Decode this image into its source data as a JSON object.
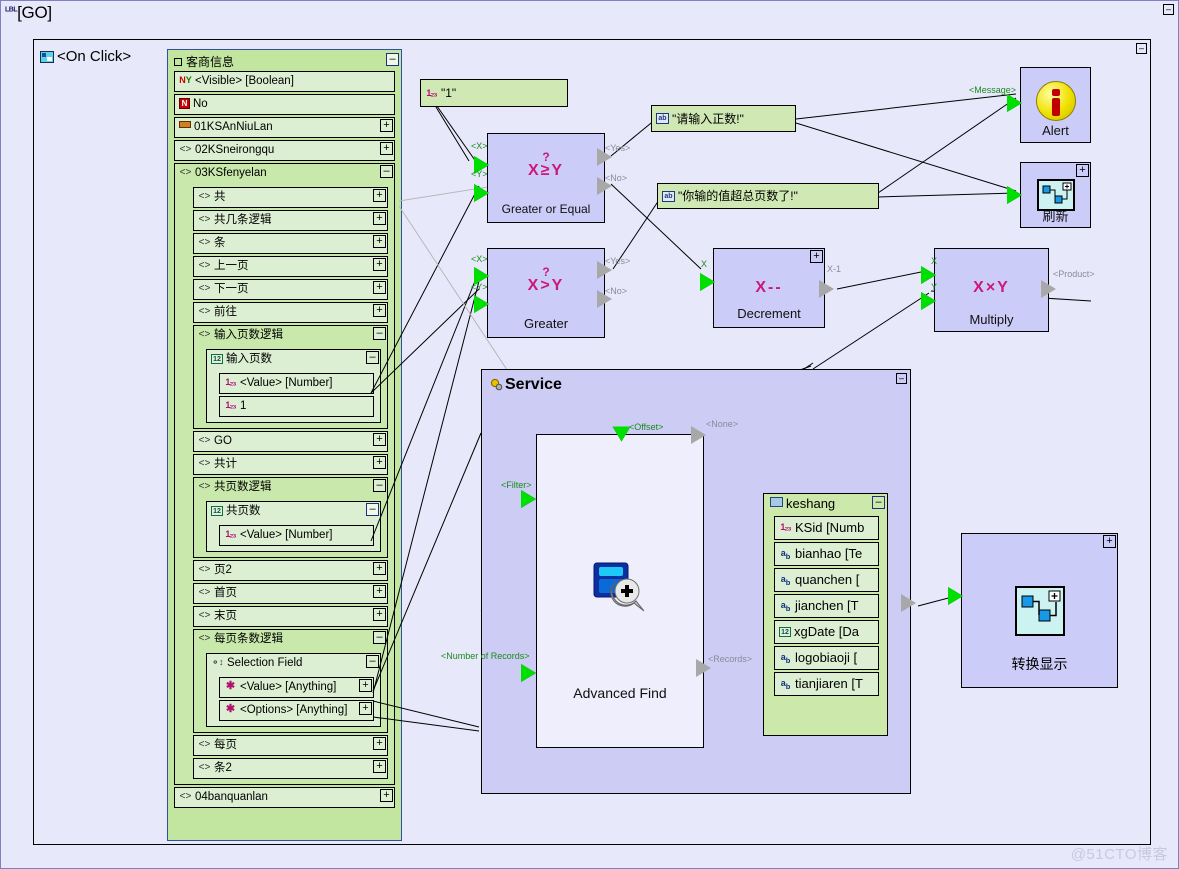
{
  "canvas": {
    "title": "[GO]",
    "badge": "LBL",
    "collapse_label": "–"
  },
  "group": {
    "label": "<On Click>",
    "icon": "event-handler-icon",
    "collapse_label": "–"
  },
  "tree": {
    "title": "客商信息",
    "collapse_label": "–",
    "items": [
      {
        "label": "<Visible> [Boolean]",
        "icon": "yes-no-icon",
        "indent": 0,
        "toggle": ""
      },
      {
        "label": "No",
        "icon": "no-icon",
        "indent": 0,
        "toggle": ""
      },
      {
        "label": "01KSAnNiuLan",
        "icon": "toolbar-icon",
        "indent": 0,
        "toggle": "+"
      },
      {
        "label": "02KSneirongqu",
        "icon": "container-icon",
        "indent": 0,
        "toggle": "+"
      },
      {
        "label": "03KSfenyelan",
        "icon": "container-icon",
        "indent": 0,
        "toggle": "–",
        "children": [
          {
            "label": "共",
            "icon": "container-icon",
            "indent": 1,
            "toggle": "+"
          },
          {
            "label": "共几条逻辑",
            "icon": "container-icon",
            "indent": 1,
            "toggle": "+"
          },
          {
            "label": "条",
            "icon": "container-icon",
            "indent": 1,
            "toggle": "+"
          },
          {
            "label": "上一页",
            "icon": "container-icon",
            "indent": 1,
            "toggle": "+"
          },
          {
            "label": "下一页",
            "icon": "container-icon",
            "indent": 1,
            "toggle": "+"
          },
          {
            "label": "前往",
            "icon": "container-icon",
            "indent": 1,
            "toggle": "+"
          },
          {
            "label": "输入页数逻辑",
            "icon": "container-icon",
            "indent": 1,
            "toggle": "–",
            "children": [
              {
                "label": "输入页数",
                "icon": "textbox-icon",
                "indent": 2,
                "toggle": "–",
                "children": [
                  {
                    "label": "<Value> [Number]",
                    "icon": "number-icon",
                    "indent": 3,
                    "toggle": ""
                  },
                  {
                    "label": "1",
                    "icon": "number-icon",
                    "indent": 3,
                    "toggle": ""
                  }
                ]
              }
            ]
          },
          {
            "label": "GO",
            "icon": "container-icon",
            "indent": 1,
            "toggle": "+"
          },
          {
            "label": "共计",
            "icon": "container-icon",
            "indent": 1,
            "toggle": "+"
          },
          {
            "label": "共页数逻辑",
            "icon": "container-icon",
            "indent": 1,
            "toggle": "–",
            "children": [
              {
                "label": "共页数",
                "icon": "label-12-icon",
                "indent": 2,
                "toggle": "–",
                "children": [
                  {
                    "label": "<Value> [Number]",
                    "icon": "number-icon",
                    "indent": 3,
                    "toggle": ""
                  }
                ]
              }
            ]
          },
          {
            "label": "页2",
            "icon": "container-icon",
            "indent": 1,
            "toggle": "+"
          },
          {
            "label": "首页",
            "icon": "container-icon",
            "indent": 1,
            "toggle": "+"
          },
          {
            "label": "末页",
            "icon": "container-icon",
            "indent": 1,
            "toggle": "+"
          },
          {
            "label": "每页条数逻辑",
            "icon": "container-icon",
            "indent": 1,
            "toggle": "–",
            "children": [
              {
                "label": "Selection Field",
                "icon": "selection-field-icon",
                "indent": 2,
                "toggle": "–",
                "children": [
                  {
                    "label": "<Value> [Anything]",
                    "icon": "anything-icon",
                    "indent": 3,
                    "toggle": "+"
                  },
                  {
                    "label": "<Options> [Anything]",
                    "icon": "anything-icon",
                    "indent": 3,
                    "toggle": "+"
                  }
                ]
              }
            ]
          },
          {
            "label": "每页",
            "icon": "container-icon",
            "indent": 1,
            "toggle": "+"
          },
          {
            "label": "条2",
            "icon": "container-icon",
            "indent": 1,
            "toggle": "+"
          }
        ]
      },
      {
        "label": "04banquanlan",
        "icon": "container-icon",
        "indent": 0,
        "toggle": "+"
      }
    ]
  },
  "literals": {
    "one": {
      "value": "\"1\"",
      "icon": "number-icon"
    },
    "msg_positive": {
      "value": "\"请输入正数!\"",
      "icon": "text-icon"
    },
    "msg_overflow": {
      "value": "\"你输的值超总页数了!\"",
      "icon": "text-icon"
    }
  },
  "nodes": {
    "greater_or_equal": {
      "name": "Greater or Equal",
      "glyph": "X≥Y",
      "question": "?",
      "inputs": [
        "<X>",
        "<Y>"
      ],
      "outputs": [
        "<Yes>",
        "<No>"
      ],
      "expand": ""
    },
    "greater": {
      "name": "Greater",
      "glyph": "X>Y",
      "question": "?",
      "inputs": [
        "<X>",
        "<Y>"
      ],
      "outputs": [
        "<Yes>",
        "<No>"
      ],
      "expand": ""
    },
    "decrement": {
      "name": "Decrement",
      "glyph": "X--",
      "question": "",
      "inputs": [
        "X"
      ],
      "outputs": [
        "X-1"
      ],
      "expand": "+"
    },
    "multiply": {
      "name": "Multiply",
      "glyph": "X×Y",
      "question": "",
      "inputs": [
        "X",
        "Y"
      ],
      "outputs": [
        "<Product>"
      ],
      "expand": ""
    },
    "alert": {
      "name": "Alert",
      "icon": "alert-info-icon",
      "inputs": [
        "<Message>"
      ],
      "expand": ""
    },
    "refresh": {
      "name": "刷新",
      "icon": "refresh-diagram-icon",
      "inputs": [
        ""
      ],
      "expand": "+"
    },
    "transform_display": {
      "name": "转换显示",
      "icon": "diagram-icon",
      "expand": "+"
    }
  },
  "service": {
    "title": "Service",
    "icon": "service-gear-icon",
    "collapse_label": "–",
    "advanced_find": {
      "name": "Advanced Find",
      "icon": "advanced-find-icon",
      "inputs": [
        "<Offset>",
        "<Filter>",
        "<Number of Records>"
      ],
      "outputs": [
        "<None>",
        "<Records>"
      ]
    },
    "entity": {
      "name": "keshang",
      "icon": "table-icon",
      "collapse_label": "–",
      "fields": [
        {
          "label": "KSid [Numb",
          "icon": "number-icon"
        },
        {
          "label": "bianhao [Te",
          "icon": "text-field-icon"
        },
        {
          "label": "quanchen [",
          "icon": "text-field-icon"
        },
        {
          "label": "jianchen [T",
          "icon": "text-field-icon"
        },
        {
          "label": "xgDate [Da",
          "icon": "date-icon"
        },
        {
          "label": "logobiaoji [",
          "icon": "text-field-icon"
        },
        {
          "label": "tianjiaren [T",
          "icon": "text-field-icon"
        }
      ]
    }
  },
  "watermark": "@51CTO博客",
  "colors": {
    "canvas_bg": "#e8e8fb",
    "node_fill": "#ccccf8",
    "service_fill": "#ccccf5",
    "tree_container": "#c2e5a0",
    "tree_item": "#dcefd2",
    "value_box": "#cfe8b4",
    "port_in": "#00e000",
    "port_out": "#a8a8a8",
    "glyph": "#cc1878",
    "port_label": "#1a8a1a",
    "port_label_gray": "#8a8a9a"
  }
}
